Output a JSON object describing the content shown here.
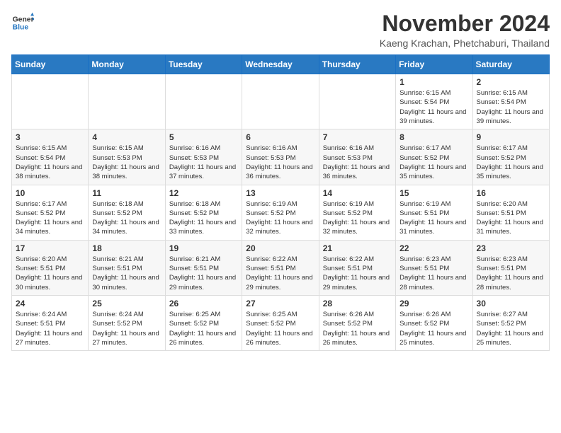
{
  "header": {
    "logo_line1": "General",
    "logo_line2": "Blue",
    "title": "November 2024",
    "subtitle": "Kaeng Krachan, Phetchaburi, Thailand"
  },
  "weekdays": [
    "Sunday",
    "Monday",
    "Tuesday",
    "Wednesday",
    "Thursday",
    "Friday",
    "Saturday"
  ],
  "weeks": [
    [
      {
        "day": "",
        "info": ""
      },
      {
        "day": "",
        "info": ""
      },
      {
        "day": "",
        "info": ""
      },
      {
        "day": "",
        "info": ""
      },
      {
        "day": "",
        "info": ""
      },
      {
        "day": "1",
        "info": "Sunrise: 6:15 AM\nSunset: 5:54 PM\nDaylight: 11 hours\nand 39 minutes."
      },
      {
        "day": "2",
        "info": "Sunrise: 6:15 AM\nSunset: 5:54 PM\nDaylight: 11 hours\nand 39 minutes."
      }
    ],
    [
      {
        "day": "3",
        "info": "Sunrise: 6:15 AM\nSunset: 5:54 PM\nDaylight: 11 hours\nand 38 minutes."
      },
      {
        "day": "4",
        "info": "Sunrise: 6:15 AM\nSunset: 5:53 PM\nDaylight: 11 hours\nand 38 minutes."
      },
      {
        "day": "5",
        "info": "Sunrise: 6:16 AM\nSunset: 5:53 PM\nDaylight: 11 hours\nand 37 minutes."
      },
      {
        "day": "6",
        "info": "Sunrise: 6:16 AM\nSunset: 5:53 PM\nDaylight: 11 hours\nand 36 minutes."
      },
      {
        "day": "7",
        "info": "Sunrise: 6:16 AM\nSunset: 5:53 PM\nDaylight: 11 hours\nand 36 minutes."
      },
      {
        "day": "8",
        "info": "Sunrise: 6:17 AM\nSunset: 5:52 PM\nDaylight: 11 hours\nand 35 minutes."
      },
      {
        "day": "9",
        "info": "Sunrise: 6:17 AM\nSunset: 5:52 PM\nDaylight: 11 hours\nand 35 minutes."
      }
    ],
    [
      {
        "day": "10",
        "info": "Sunrise: 6:17 AM\nSunset: 5:52 PM\nDaylight: 11 hours\nand 34 minutes."
      },
      {
        "day": "11",
        "info": "Sunrise: 6:18 AM\nSunset: 5:52 PM\nDaylight: 11 hours\nand 34 minutes."
      },
      {
        "day": "12",
        "info": "Sunrise: 6:18 AM\nSunset: 5:52 PM\nDaylight: 11 hours\nand 33 minutes."
      },
      {
        "day": "13",
        "info": "Sunrise: 6:19 AM\nSunset: 5:52 PM\nDaylight: 11 hours\nand 32 minutes."
      },
      {
        "day": "14",
        "info": "Sunrise: 6:19 AM\nSunset: 5:52 PM\nDaylight: 11 hours\nand 32 minutes."
      },
      {
        "day": "15",
        "info": "Sunrise: 6:19 AM\nSunset: 5:51 PM\nDaylight: 11 hours\nand 31 minutes."
      },
      {
        "day": "16",
        "info": "Sunrise: 6:20 AM\nSunset: 5:51 PM\nDaylight: 11 hours\nand 31 minutes."
      }
    ],
    [
      {
        "day": "17",
        "info": "Sunrise: 6:20 AM\nSunset: 5:51 PM\nDaylight: 11 hours\nand 30 minutes."
      },
      {
        "day": "18",
        "info": "Sunrise: 6:21 AM\nSunset: 5:51 PM\nDaylight: 11 hours\nand 30 minutes."
      },
      {
        "day": "19",
        "info": "Sunrise: 6:21 AM\nSunset: 5:51 PM\nDaylight: 11 hours\nand 29 minutes."
      },
      {
        "day": "20",
        "info": "Sunrise: 6:22 AM\nSunset: 5:51 PM\nDaylight: 11 hours\nand 29 minutes."
      },
      {
        "day": "21",
        "info": "Sunrise: 6:22 AM\nSunset: 5:51 PM\nDaylight: 11 hours\nand 29 minutes."
      },
      {
        "day": "22",
        "info": "Sunrise: 6:23 AM\nSunset: 5:51 PM\nDaylight: 11 hours\nand 28 minutes."
      },
      {
        "day": "23",
        "info": "Sunrise: 6:23 AM\nSunset: 5:51 PM\nDaylight: 11 hours\nand 28 minutes."
      }
    ],
    [
      {
        "day": "24",
        "info": "Sunrise: 6:24 AM\nSunset: 5:51 PM\nDaylight: 11 hours\nand 27 minutes."
      },
      {
        "day": "25",
        "info": "Sunrise: 6:24 AM\nSunset: 5:52 PM\nDaylight: 11 hours\nand 27 minutes."
      },
      {
        "day": "26",
        "info": "Sunrise: 6:25 AM\nSunset: 5:52 PM\nDaylight: 11 hours\nand 26 minutes."
      },
      {
        "day": "27",
        "info": "Sunrise: 6:25 AM\nSunset: 5:52 PM\nDaylight: 11 hours\nand 26 minutes."
      },
      {
        "day": "28",
        "info": "Sunrise: 6:26 AM\nSunset: 5:52 PM\nDaylight: 11 hours\nand 26 minutes."
      },
      {
        "day": "29",
        "info": "Sunrise: 6:26 AM\nSunset: 5:52 PM\nDaylight: 11 hours\nand 25 minutes."
      },
      {
        "day": "30",
        "info": "Sunrise: 6:27 AM\nSunset: 5:52 PM\nDaylight: 11 hours\nand 25 minutes."
      }
    ]
  ]
}
